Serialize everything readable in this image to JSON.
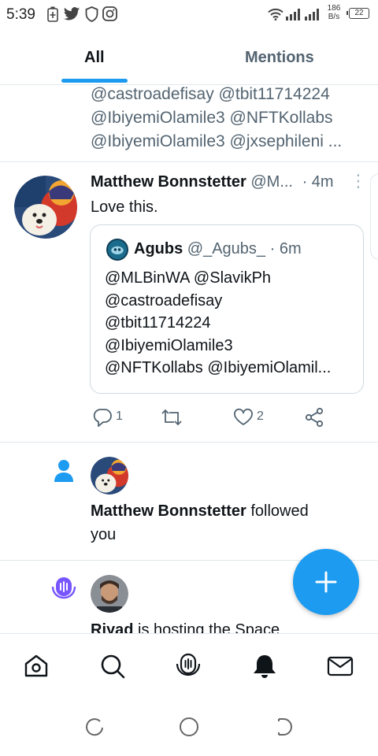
{
  "status_bar": {
    "time": "5:39",
    "net_speed_value": "186",
    "net_speed_unit": "B/s",
    "battery": "22",
    "icons": [
      "battery-saver-icon",
      "twitter-icon",
      "shield-icon",
      "instagram-icon",
      "wifi-icon",
      "signal-icon",
      "signal-icon"
    ]
  },
  "tabs": [
    {
      "label": "All",
      "active": true
    },
    {
      "label": "Mentions",
      "active": false
    }
  ],
  "prev_tweet_lines": [
    "@castroadefisay @tbit11714224",
    "@IbiyemiOlamile3 @NFTKollabs",
    "@IbiyemiOlamile3 @jxsephileni ..."
  ],
  "tweet": {
    "author_name": "Matthew Bonnstetter",
    "author_handle": "@M...",
    "time": "· 4m",
    "text": "Love this.",
    "quote": {
      "author_name": "Agubs",
      "author_handle": "@_Agubs_",
      "time": "· 6m",
      "lines": [
        "@MLBinWA @SlavikPh",
        "@castroadefisay",
        "@tbit11714224",
        "@IbiyemiOlamile3",
        "@NFTKollabs @IbiyemiOlamil..."
      ]
    },
    "actions": {
      "reply_count": "1",
      "retweet_count": "",
      "like_count": "2"
    }
  },
  "notifications": [
    {
      "type": "follow",
      "icon": "person-icon",
      "name": "Matthew Bonnstetter",
      "action_line1": " followed",
      "action_line2": "you"
    },
    {
      "type": "space",
      "icon": "spaces-mic-icon",
      "name": "Riyad",
      "action_line1": " is hosting the Space"
    }
  ],
  "bottom_nav": [
    "home-icon",
    "search-icon",
    "spaces-icon",
    "notifications-icon",
    "messages-icon"
  ],
  "colors": {
    "accent": "#1d9bf0",
    "text_primary": "#0f1419",
    "text_secondary": "#536471",
    "spaces_purple": "#7856ff",
    "divider": "#e1e8ed"
  }
}
